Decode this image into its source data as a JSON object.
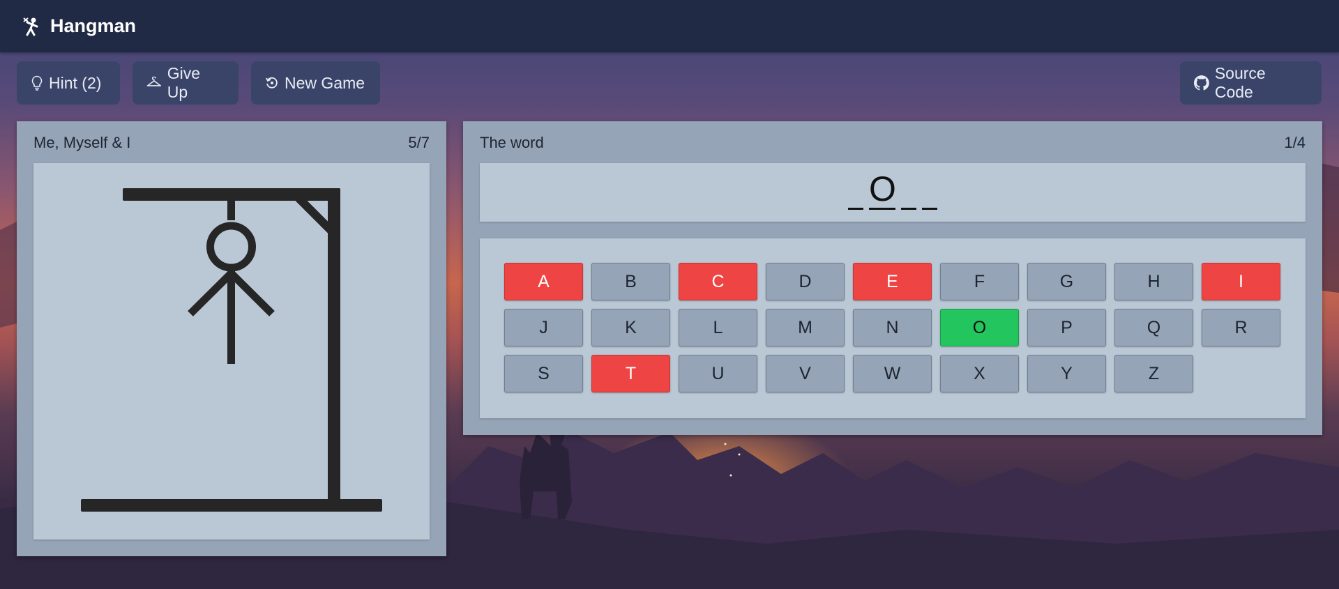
{
  "app": {
    "title": "Hangman",
    "logo_icon": "hangman-logo-icon"
  },
  "toolbar": {
    "hint_label": "Hint (2)",
    "give_up_label": "Give Up",
    "new_game_label": "New Game",
    "source_label": "Source Code"
  },
  "gallows_panel": {
    "category": "Me, Myself & I",
    "mistakes": "5/7"
  },
  "word_panel": {
    "title": "The word",
    "progress": "1/4",
    "letters": [
      "",
      "O",
      "",
      ""
    ]
  },
  "keyboard": {
    "keys": [
      {
        "letter": "A",
        "state": "wrong"
      },
      {
        "letter": "B",
        "state": "unused"
      },
      {
        "letter": "C",
        "state": "wrong"
      },
      {
        "letter": "D",
        "state": "unused"
      },
      {
        "letter": "E",
        "state": "wrong"
      },
      {
        "letter": "F",
        "state": "unused"
      },
      {
        "letter": "G",
        "state": "unused"
      },
      {
        "letter": "H",
        "state": "unused"
      },
      {
        "letter": "I",
        "state": "wrong"
      },
      {
        "letter": "J",
        "state": "unused"
      },
      {
        "letter": "K",
        "state": "unused"
      },
      {
        "letter": "L",
        "state": "unused"
      },
      {
        "letter": "M",
        "state": "unused"
      },
      {
        "letter": "N",
        "state": "unused"
      },
      {
        "letter": "O",
        "state": "correct"
      },
      {
        "letter": "P",
        "state": "unused"
      },
      {
        "letter": "Q",
        "state": "unused"
      },
      {
        "letter": "R",
        "state": "unused"
      },
      {
        "letter": "S",
        "state": "unused"
      },
      {
        "letter": "T",
        "state": "wrong"
      },
      {
        "letter": "U",
        "state": "unused"
      },
      {
        "letter": "V",
        "state": "unused"
      },
      {
        "letter": "W",
        "state": "unused"
      },
      {
        "letter": "X",
        "state": "unused"
      },
      {
        "letter": "Y",
        "state": "unused"
      },
      {
        "letter": "Z",
        "state": "unused"
      }
    ]
  },
  "colors": {
    "navbar": "#202a45",
    "panel": "#96a4b8",
    "inner": "#bac8d5",
    "wrong": "#ef4444",
    "correct": "#22c55e"
  }
}
